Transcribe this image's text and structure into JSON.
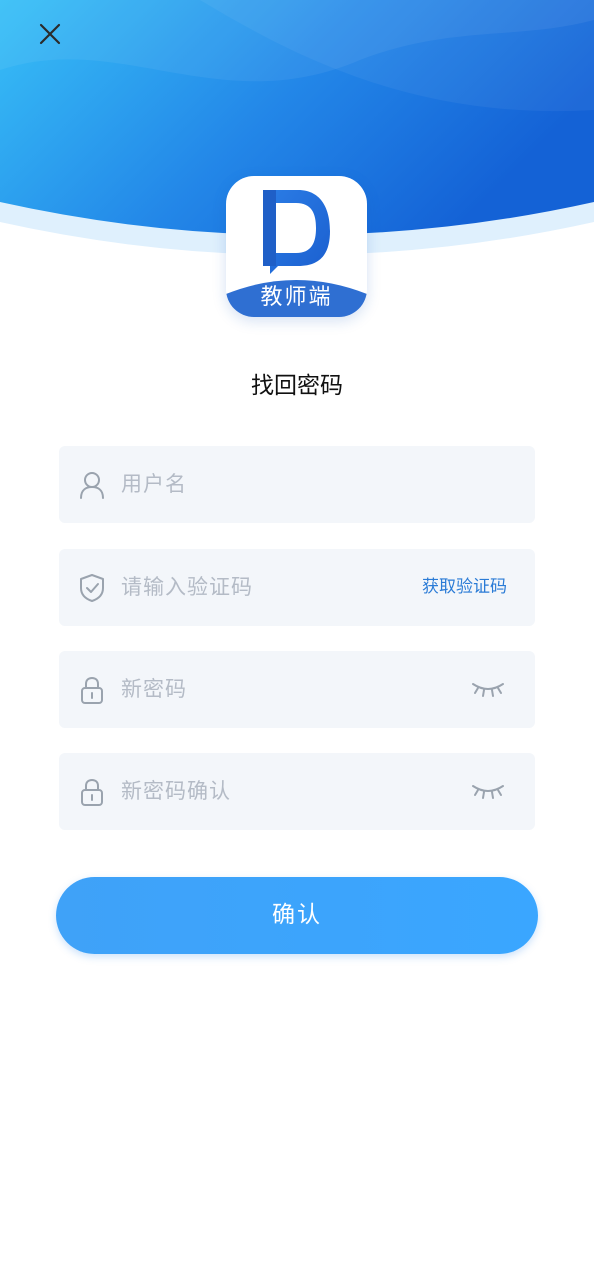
{
  "colors": {
    "header_gradient_start": "#35b6f5",
    "header_gradient_end": "#1565d8",
    "accent": "#2a7bd6",
    "button": "#3aa3fb",
    "field_bg": "#f3f6fa",
    "placeholder": "#b4bbc6"
  },
  "header": {
    "close_icon": "close-icon"
  },
  "logo": {
    "letter": "D",
    "label": "教师端"
  },
  "page": {
    "title": "找回密码"
  },
  "form": {
    "username": {
      "placeholder": "用户名",
      "icon": "user-icon"
    },
    "code": {
      "placeholder": "请输入验证码",
      "icon": "shield-check-icon",
      "action_label": "获取验证码"
    },
    "new_password": {
      "placeholder": "新密码",
      "icon": "lock-icon",
      "toggle_icon": "eye-closed-icon"
    },
    "confirm_password": {
      "placeholder": "新密码确认",
      "icon": "lock-icon",
      "toggle_icon": "eye-closed-icon"
    }
  },
  "actions": {
    "confirm_label": "确认"
  }
}
